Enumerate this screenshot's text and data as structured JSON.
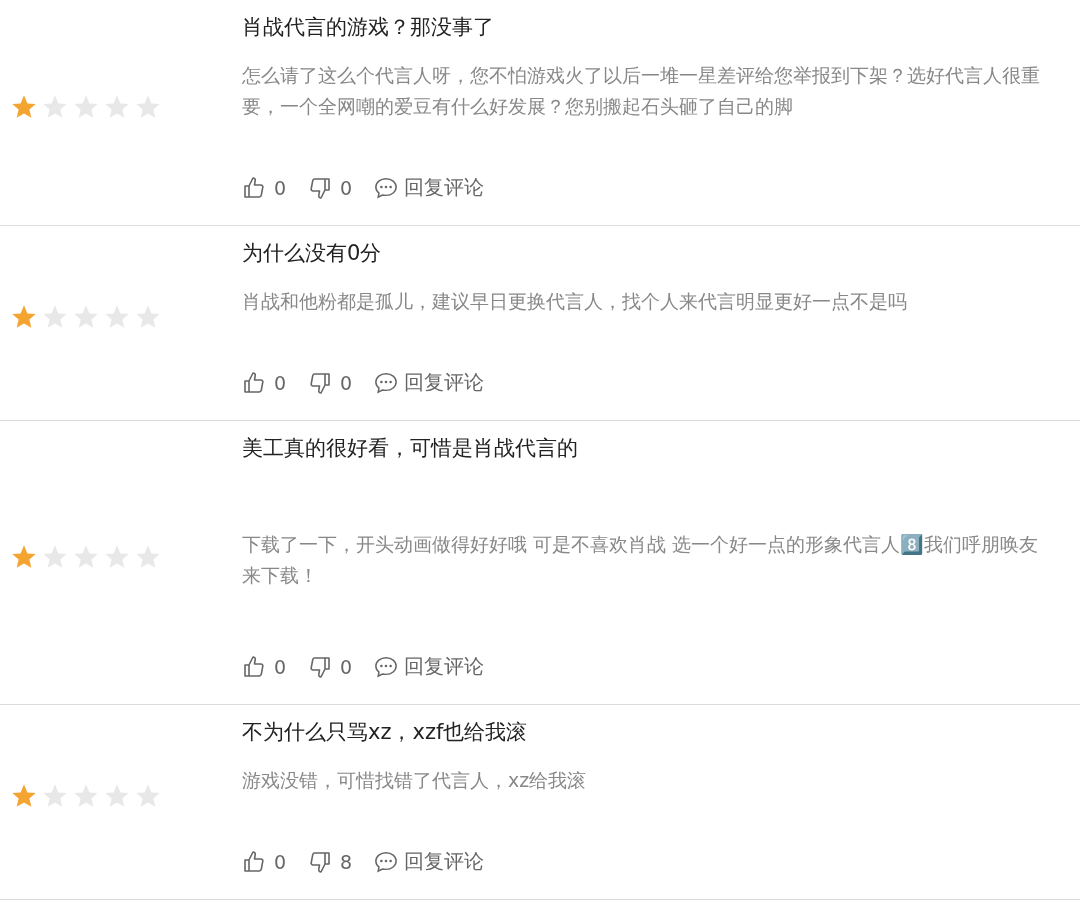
{
  "reviews": [
    {
      "stars": 1,
      "title": "肖战代言的游戏？那没事了",
      "body": "怎么请了这么个代言人呀，您不怕游戏火了以后一堆一星差评给您举报到下架？选好代言人很重要，一个全网嘲的爱豆有什么好发展？您别搬起石头砸了自己的脚",
      "likes": "0",
      "dislikes": "0",
      "reply": "回复评论"
    },
    {
      "stars": 1,
      "title": "为什么没有0分",
      "body": "肖战和他粉都是孤儿，建议早日更换代言人，找个人来代言明显更好一点不是吗",
      "likes": "0",
      "dislikes": "0",
      "reply": "回复评论"
    },
    {
      "stars": 1,
      "title": "美工真的很好看，可惜是肖战代言的",
      "body": "下载了一下，开头动画做得好好哦 可是不喜欢肖战 选一个好一点的形象代言人8️⃣我们呼朋唤友来下载！",
      "likes": "0",
      "dislikes": "0",
      "reply": "回复评论"
    },
    {
      "stars": 1,
      "title": "不为什么只骂xz，xzf也给我滚",
      "body": "游戏没错，可惜找错了代言人，xz给我滚",
      "likes": "0",
      "dislikes": "8",
      "reply": "回复评论"
    }
  ]
}
